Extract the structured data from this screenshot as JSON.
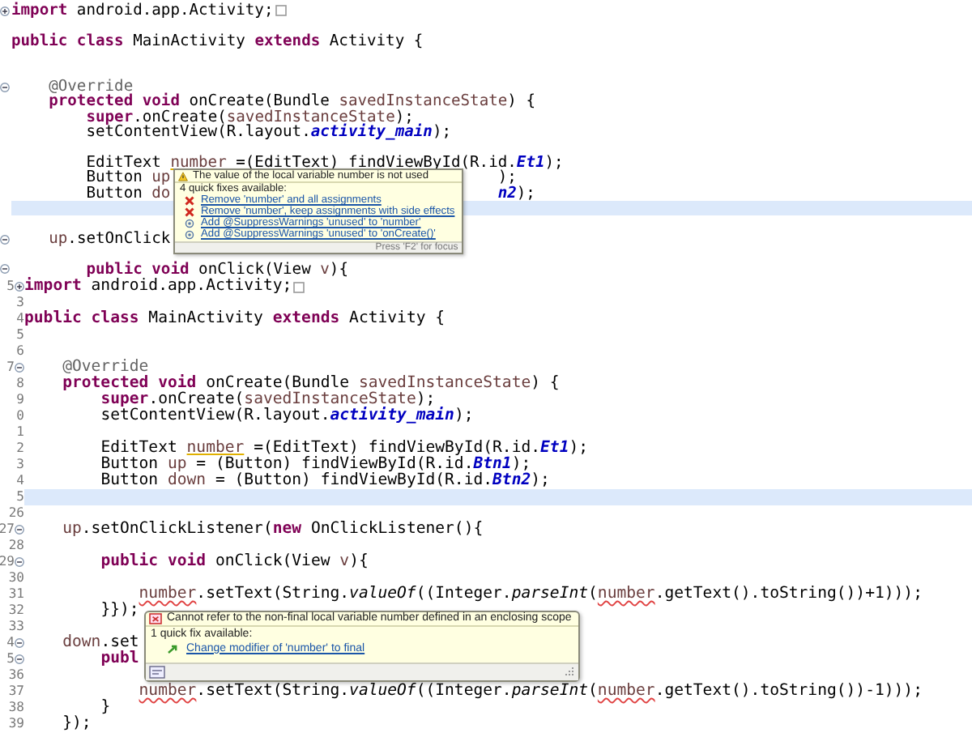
{
  "panels": [
    {
      "lines": [
        {
          "current": false,
          "expanded": false,
          "folded": true,
          "tokens": [
            {
              "t": "import",
              "kind": "kw"
            },
            {
              "t": " android.app.Activity;",
              "kind": "plain"
            }
          ]
        },
        {
          "current": false
        },
        {
          "current": false,
          "tokens": [
            {
              "t": "public class",
              "kind": "kw"
            },
            {
              "t": " MainActivity ",
              "kind": "plain"
            },
            {
              "t": "extends",
              "kind": "kw"
            },
            {
              "t": " Activity {",
              "kind": "plain"
            }
          ]
        },
        {
          "current": false
        },
        {
          "current": false
        },
        {
          "current": false,
          "expanded": true,
          "tokens": [
            {
              "t": "    @Override",
              "kind": "ann"
            }
          ]
        },
        {
          "current": false,
          "tokens": [
            {
              "t": "    protected void",
              "kind": "kw"
            },
            {
              "t": " onCreate(Bundle ",
              "kind": "plain"
            },
            {
              "t": "savedInstanceState",
              "kind": "var"
            },
            {
              "t": ") {",
              "kind": "plain"
            }
          ]
        },
        {
          "current": false,
          "tokens": [
            {
              "t": "        super",
              "kind": "kw"
            },
            {
              "t": ".onCreate(",
              "kind": "plain"
            },
            {
              "t": "savedInstanceState",
              "kind": "var"
            },
            {
              "t": ");",
              "kind": "plain"
            }
          ]
        },
        {
          "current": false,
          "tokens": [
            {
              "t": "        setContentView(R.layout.",
              "kind": "plain"
            },
            {
              "t": "activity_main",
              "kind": "field"
            },
            {
              "t": ");",
              "kind": "plain"
            }
          ]
        },
        {
          "current": false
        },
        {
          "current": false,
          "tokens": [
            {
              "t": "        EditText ",
              "kind": "plain"
            },
            {
              "t": "number",
              "kind": "warn"
            },
            {
              "t": " =(EditText) findViewById(R.id.",
              "kind": "plain"
            },
            {
              "t": "Et1",
              "kind": "field"
            },
            {
              "t": ");",
              "kind": "plain"
            }
          ]
        },
        {
          "current": false,
          "tokens": [
            {
              "t": "        Button ",
              "kind": "plain"
            },
            {
              "t": "up",
              "kind": "var"
            }
          ],
          "right": [
            {
              "t": ");",
              "kind": "plain"
            }
          ],
          "popup": {
            "kind": "warning",
            "message": "The value of the local variable number is not used",
            "heading": "4 quick fixes available:",
            "fixes": [
              {
                "kind": "remove",
                "label": "Remove 'number' and all assignments"
              },
              {
                "kind": "remove",
                "label": "Remove 'number', keep assignments with side effects"
              },
              {
                "kind": "suppress",
                "label": "Add @SuppressWarnings 'unused' to 'number'"
              },
              {
                "kind": "suppress",
                "label": "Add @SuppressWarnings 'unused' to 'onCreate()'"
              }
            ],
            "footer": "Press 'F2' for focus",
            "footer_icon": false
          }
        },
        {
          "current": false,
          "tokens": [
            {
              "t": "        Button ",
              "kind": "plain"
            },
            {
              "t": "do",
              "kind": "var"
            }
          ],
          "right": [
            {
              "t": "n2",
              "kind": "field"
            },
            {
              "t": ");",
              "kind": "plain"
            }
          ]
        },
        {
          "current": true
        },
        {
          "current": false
        },
        {
          "current": false,
          "expanded": true,
          "tokens": [
            {
              "t": "    up",
              "kind": "var"
            },
            {
              "t": ".setOnClick",
              "kind": "plain"
            }
          ]
        },
        {
          "current": false
        },
        {
          "current": false,
          "expanded": true,
          "tokens": [
            {
              "t": "        public void",
              "kind": "kw"
            },
            {
              "t": " onClick(View ",
              "kind": "plain"
            },
            {
              "t": "v",
              "kind": "var"
            },
            {
              "t": "){",
              "kind": "plain"
            }
          ]
        }
      ]
    },
    {
      "lines": [
        {
          "number": "5",
          "current": false,
          "expanded": false,
          "folded": true,
          "tokens": [
            {
              "t": "import",
              "kind": "kw"
            },
            {
              "t": " android.app.Activity;",
              "kind": "plain"
            }
          ]
        },
        {
          "number": "3",
          "current": false
        },
        {
          "number": "4",
          "current": false,
          "tokens": [
            {
              "t": "public class",
              "kind": "kw"
            },
            {
              "t": " MainActivity ",
              "kind": "plain"
            },
            {
              "t": "extends",
              "kind": "kw"
            },
            {
              "t": " Activity {",
              "kind": "plain"
            }
          ]
        },
        {
          "number": "5",
          "current": false
        },
        {
          "number": "6",
          "current": false
        },
        {
          "number": "7",
          "current": false,
          "expanded": true,
          "tokens": [
            {
              "t": "    @Override",
              "kind": "ann"
            }
          ]
        },
        {
          "number": "8",
          "current": false,
          "tokens": [
            {
              "t": "    protected void",
              "kind": "kw"
            },
            {
              "t": " onCreate(Bundle ",
              "kind": "plain"
            },
            {
              "t": "savedInstanceState",
              "kind": "var"
            },
            {
              "t": ") {",
              "kind": "plain"
            }
          ]
        },
        {
          "number": "9",
          "current": false,
          "tokens": [
            {
              "t": "        super",
              "kind": "kw"
            },
            {
              "t": ".onCreate(",
              "kind": "plain"
            },
            {
              "t": "savedInstanceState",
              "kind": "var"
            },
            {
              "t": ");",
              "kind": "plain"
            }
          ]
        },
        {
          "number": "0",
          "current": false,
          "tokens": [
            {
              "t": "        setContentView(R.layout.",
              "kind": "plain"
            },
            {
              "t": "activity_main",
              "kind": "field"
            },
            {
              "t": ");",
              "kind": "plain"
            }
          ]
        },
        {
          "number": "1",
          "current": false
        },
        {
          "number": "2",
          "current": false,
          "tokens": [
            {
              "t": "        EditText ",
              "kind": "plain"
            },
            {
              "t": "number",
              "kind": "warn"
            },
            {
              "t": " =(EditText) findViewById(R.id.",
              "kind": "plain"
            },
            {
              "t": "Et1",
              "kind": "field"
            },
            {
              "t": ");",
              "kind": "plain"
            }
          ]
        },
        {
          "number": "3",
          "current": false,
          "tokens": [
            {
              "t": "        Button ",
              "kind": "plain"
            },
            {
              "t": "up",
              "kind": "var"
            },
            {
              "t": " = (Button) findViewById(R.id.",
              "kind": "plain"
            },
            {
              "t": "Btn1",
              "kind": "field"
            },
            {
              "t": ");",
              "kind": "plain"
            }
          ]
        },
        {
          "number": "4",
          "current": false,
          "tokens": [
            {
              "t": "        Button ",
              "kind": "plain"
            },
            {
              "t": "down",
              "kind": "var"
            },
            {
              "t": " = (Button) findViewById(R.id.",
              "kind": "plain"
            },
            {
              "t": "Btn2",
              "kind": "field"
            },
            {
              "t": ");",
              "kind": "plain"
            }
          ]
        },
        {
          "number": "5",
          "current": true
        },
        {
          "number": "26",
          "current": false
        },
        {
          "number": "27",
          "current": false,
          "expanded": true,
          "tokens": [
            {
              "t": "    up",
              "kind": "var"
            },
            {
              "t": ".setOnClickListener(",
              "kind": "plain"
            },
            {
              "t": "new",
              "kind": "kw"
            },
            {
              "t": " OnClickListener(){",
              "kind": "plain"
            }
          ]
        },
        {
          "number": "28",
          "current": false
        },
        {
          "number": "29",
          "current": false,
          "expanded": true,
          "tokens": [
            {
              "t": "        public void",
              "kind": "kw"
            },
            {
              "t": " onClick(View ",
              "kind": "plain"
            },
            {
              "t": "v",
              "kind": "var"
            },
            {
              "t": "){",
              "kind": "plain"
            }
          ]
        },
        {
          "number": "30",
          "current": false
        },
        {
          "number": "31",
          "current": false,
          "tokens": [
            {
              "t": "            number",
              "kind": "err"
            },
            {
              "t": ".setText(String.",
              "kind": "plain"
            },
            {
              "t": "valueOf",
              "kind": "static"
            },
            {
              "t": "((Integer.",
              "kind": "plain"
            },
            {
              "t": "parseInt",
              "kind": "static"
            },
            {
              "t": "(",
              "kind": "plain"
            },
            {
              "t": "number",
              "kind": "err"
            },
            {
              "t": ".getText().toString())+1)));",
              "kind": "plain"
            }
          ]
        },
        {
          "number": "32",
          "current": false,
          "tokens": [
            {
              "t": "        }});",
              "kind": "plain"
            }
          ],
          "popup": {
            "kind": "error",
            "message": "Cannot refer to the non-final local variable number defined in an enclosing scope",
            "heading": "1 quick fix available:",
            "fixes": [
              {
                "kind": "change",
                "label": "Change modifier of 'number' to final"
              }
            ],
            "footer_icon": true
          }
        },
        {
          "number": "33",
          "current": false
        },
        {
          "number": "4",
          "current": false,
          "expanded": true,
          "tokens": [
            {
              "t": "    down",
              "kind": "var"
            },
            {
              "t": ".set",
              "kind": "plain"
            }
          ]
        },
        {
          "number": "5",
          "current": false,
          "expanded": true,
          "tokens": [
            {
              "t": "        publ",
              "kind": "kw"
            }
          ]
        },
        {
          "number": "36",
          "current": false
        },
        {
          "number": "37",
          "current": false,
          "tokens": [
            {
              "t": "            number",
              "kind": "err"
            },
            {
              "t": ".setText(String.",
              "kind": "plain"
            },
            {
              "t": "valueOf",
              "kind": "static"
            },
            {
              "t": "((Integer.",
              "kind": "plain"
            },
            {
              "t": "parseInt",
              "kind": "static"
            },
            {
              "t": "(",
              "kind": "plain"
            },
            {
              "t": "number",
              "kind": "err"
            },
            {
              "t": ".getText().toString())-1)));",
              "kind": "plain"
            }
          ]
        },
        {
          "number": "38",
          "current": false,
          "tokens": [
            {
              "t": "        }",
              "kind": "plain"
            }
          ]
        },
        {
          "number": "39",
          "current": false,
          "tokens": [
            {
              "t": "    });",
              "kind": "plain"
            }
          ]
        }
      ]
    }
  ]
}
